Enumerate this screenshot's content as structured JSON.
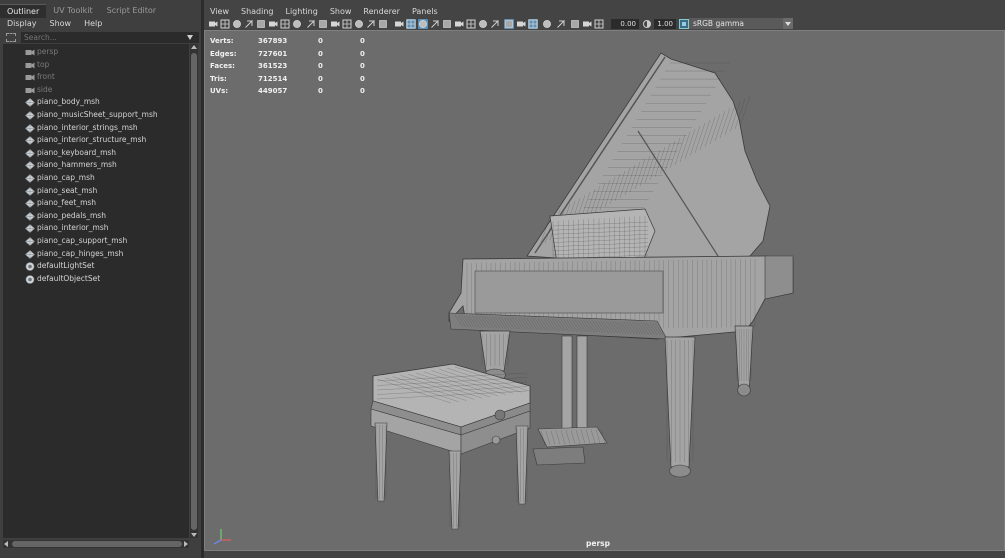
{
  "outliner": {
    "tabs": [
      {
        "label": "Outliner",
        "active": true
      },
      {
        "label": "UV Toolkit",
        "active": false
      },
      {
        "label": "Script Editor",
        "active": false
      }
    ],
    "menu": [
      "Display",
      "Show",
      "Help"
    ],
    "search": {
      "placeholder": "Search...",
      "value": ""
    },
    "items": [
      {
        "label": "persp",
        "icon": "camera-icon",
        "dim": true
      },
      {
        "label": "top",
        "icon": "camera-icon",
        "dim": true
      },
      {
        "label": "front",
        "icon": "camera-icon",
        "dim": true
      },
      {
        "label": "side",
        "icon": "camera-icon",
        "dim": true
      },
      {
        "label": "piano_body_msh",
        "icon": "mesh-icon",
        "dim": false
      },
      {
        "label": "piano_musicSheet_support_msh",
        "icon": "mesh-icon",
        "dim": false
      },
      {
        "label": "piano_interior_strings_msh",
        "icon": "mesh-icon",
        "dim": false
      },
      {
        "label": "piano_interior_structure_msh",
        "icon": "mesh-icon",
        "dim": false
      },
      {
        "label": "piano_keyboard_msh",
        "icon": "mesh-icon",
        "dim": false
      },
      {
        "label": "piano_hammers_msh",
        "icon": "mesh-icon",
        "dim": false
      },
      {
        "label": "piano_cap_msh",
        "icon": "mesh-icon",
        "dim": false
      },
      {
        "label": "piano_seat_msh",
        "icon": "mesh-icon",
        "dim": false
      },
      {
        "label": "piano_feet_msh",
        "icon": "mesh-icon",
        "dim": false
      },
      {
        "label": "piano_pedals_msh",
        "icon": "mesh-icon",
        "dim": false
      },
      {
        "label": "piano_interior_msh",
        "icon": "mesh-icon",
        "dim": false
      },
      {
        "label": "piano_cap_support_msh",
        "icon": "mesh-icon",
        "dim": false
      },
      {
        "label": "piano_cap_hinges_msh",
        "icon": "mesh-icon",
        "dim": false
      },
      {
        "label": "defaultLightSet",
        "icon": "set-icon",
        "dim": false
      },
      {
        "label": "defaultObjectSet",
        "icon": "set-icon",
        "dim": false
      }
    ]
  },
  "viewport": {
    "menu": [
      "View",
      "Shading",
      "Lighting",
      "Show",
      "Renderer",
      "Panels"
    ],
    "toolbar": {
      "exposure": "0.00",
      "gamma": "1.00",
      "color_space": "sRGB gamma"
    },
    "hud": [
      {
        "label": "Verts:",
        "value": "367893",
        "a": "0",
        "b": "0"
      },
      {
        "label": "Edges:",
        "value": "727601",
        "a": "0",
        "b": "0"
      },
      {
        "label": "Faces:",
        "value": "361523",
        "a": "0",
        "b": "0"
      },
      {
        "label": "Tris:",
        "value": "712514",
        "a": "0",
        "b": "0"
      },
      {
        "label": "UVs:",
        "value": "449057",
        "a": "0",
        "b": "0"
      }
    ],
    "camera_label": "persp"
  },
  "colors": {
    "viewport_bg": "#6c6c6c",
    "panel_bg": "#3f3f3f",
    "tree_bg": "#2b2b2b",
    "highlight": "#5d8fb6",
    "wireframe": "#3a3a3a"
  }
}
